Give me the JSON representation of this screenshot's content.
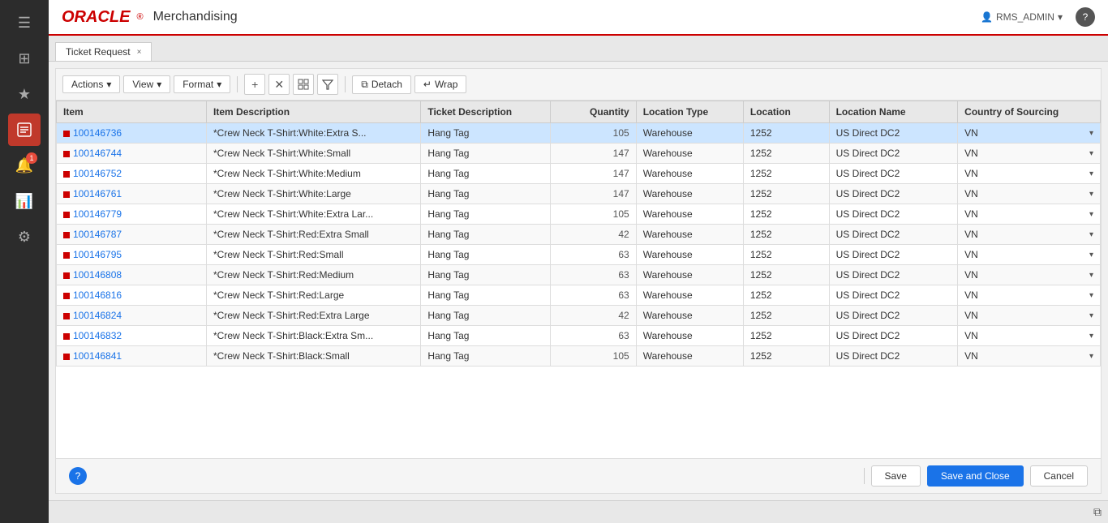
{
  "app": {
    "oracle_text": "ORACLE",
    "app_title": "Merchandising",
    "user": "RMS_ADMIN",
    "help_label": "?"
  },
  "sidebar": {
    "icons": [
      {
        "name": "menu-icon",
        "symbol": "☰",
        "active": false
      },
      {
        "name": "home-icon",
        "symbol": "⊞",
        "active": false
      },
      {
        "name": "star-icon",
        "symbol": "★",
        "active": false
      },
      {
        "name": "tasks-icon",
        "symbol": "📋",
        "active": true
      },
      {
        "name": "notification-icon",
        "symbol": "🔔",
        "active": false,
        "badge": "1"
      },
      {
        "name": "chart-icon",
        "symbol": "📊",
        "active": false
      },
      {
        "name": "settings-icon",
        "symbol": "⚙",
        "active": false
      }
    ]
  },
  "tab": {
    "label": "Ticket Request",
    "close_label": "×"
  },
  "toolbar": {
    "actions_label": "Actions",
    "view_label": "View",
    "format_label": "Format",
    "detach_label": "Detach",
    "wrap_label": "Wrap"
  },
  "table": {
    "columns": [
      {
        "key": "item",
        "label": "Item"
      },
      {
        "key": "description",
        "label": "Item Description"
      },
      {
        "key": "ticket",
        "label": "Ticket Description"
      },
      {
        "key": "quantity",
        "label": "Quantity"
      },
      {
        "key": "location_type",
        "label": "Location Type"
      },
      {
        "key": "location",
        "label": "Location"
      },
      {
        "key": "location_name",
        "label": "Location Name"
      },
      {
        "key": "country",
        "label": "Country of Sourcing"
      }
    ],
    "rows": [
      {
        "item": "100146736",
        "description": "*Crew Neck T-Shirt:White:Extra S...",
        "ticket": "Hang Tag",
        "quantity": 105,
        "location_type": "Warehouse",
        "location": "1252",
        "location_name": "US Direct DC2",
        "country": "VN",
        "selected": true
      },
      {
        "item": "100146744",
        "description": "*Crew Neck T-Shirt:White:Small",
        "ticket": "Hang Tag",
        "quantity": 147,
        "location_type": "Warehouse",
        "location": "1252",
        "location_name": "US Direct DC2",
        "country": "VN",
        "selected": false
      },
      {
        "item": "100146752",
        "description": "*Crew Neck T-Shirt:White:Medium",
        "ticket": "Hang Tag",
        "quantity": 147,
        "location_type": "Warehouse",
        "location": "1252",
        "location_name": "US Direct DC2",
        "country": "VN",
        "selected": false
      },
      {
        "item": "100146761",
        "description": "*Crew Neck T-Shirt:White:Large",
        "ticket": "Hang Tag",
        "quantity": 147,
        "location_type": "Warehouse",
        "location": "1252",
        "location_name": "US Direct DC2",
        "country": "VN",
        "selected": false
      },
      {
        "item": "100146779",
        "description": "*Crew Neck T-Shirt:White:Extra Lar...",
        "ticket": "Hang Tag",
        "quantity": 105,
        "location_type": "Warehouse",
        "location": "1252",
        "location_name": "US Direct DC2",
        "country": "VN",
        "selected": false
      },
      {
        "item": "100146787",
        "description": "*Crew Neck T-Shirt:Red:Extra Small",
        "ticket": "Hang Tag",
        "quantity": 42,
        "location_type": "Warehouse",
        "location": "1252",
        "location_name": "US Direct DC2",
        "country": "VN",
        "selected": false
      },
      {
        "item": "100146795",
        "description": "*Crew Neck T-Shirt:Red:Small",
        "ticket": "Hang Tag",
        "quantity": 63,
        "location_type": "Warehouse",
        "location": "1252",
        "location_name": "US Direct DC2",
        "country": "VN",
        "selected": false
      },
      {
        "item": "100146808",
        "description": "*Crew Neck T-Shirt:Red:Medium",
        "ticket": "Hang Tag",
        "quantity": 63,
        "location_type": "Warehouse",
        "location": "1252",
        "location_name": "US Direct DC2",
        "country": "VN",
        "selected": false
      },
      {
        "item": "100146816",
        "description": "*Crew Neck T-Shirt:Red:Large",
        "ticket": "Hang Tag",
        "quantity": 63,
        "location_type": "Warehouse",
        "location": "1252",
        "location_name": "US Direct DC2",
        "country": "VN",
        "selected": false
      },
      {
        "item": "100146824",
        "description": "*Crew Neck T-Shirt:Red:Extra Large",
        "ticket": "Hang Tag",
        "quantity": 42,
        "location_type": "Warehouse",
        "location": "1252",
        "location_name": "US Direct DC2",
        "country": "VN",
        "selected": false
      },
      {
        "item": "100146832",
        "description": "*Crew Neck T-Shirt:Black:Extra Sm...",
        "ticket": "Hang Tag",
        "quantity": 63,
        "location_type": "Warehouse",
        "location": "1252",
        "location_name": "US Direct DC2",
        "country": "VN",
        "selected": false
      },
      {
        "item": "100146841",
        "description": "*Crew Neck T-Shirt:Black:Small",
        "ticket": "Hang Tag",
        "quantity": 105,
        "location_type": "Warehouse",
        "location": "1252",
        "location_name": "US Direct DC2",
        "country": "VN",
        "selected": false
      }
    ]
  },
  "footer": {
    "save_label": "Save",
    "save_close_label": "Save and Close",
    "cancel_label": "Cancel",
    "help_label": "?"
  }
}
